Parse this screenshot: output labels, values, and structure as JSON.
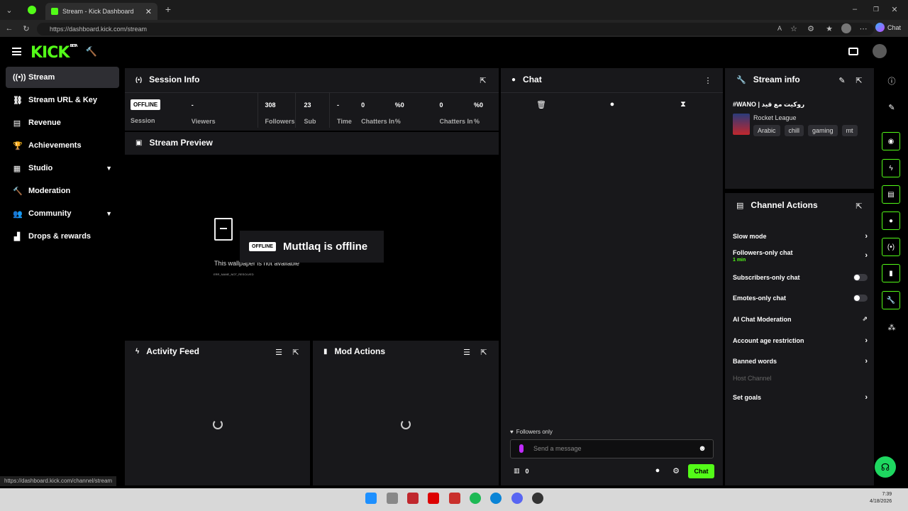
{
  "browser": {
    "tab_title": "Stream - Kick Dashboard",
    "url": "https://dashboard.kick.com/stream",
    "copilot_label": "Chat",
    "status_url": "https://dashboard.kick.com/channel/stream",
    "clock_time": "7:39",
    "clock_date": "4/18/2026"
  },
  "brand": {
    "logo": "KICK",
    "logo_sup": "BETA",
    "accent": "#53fc18"
  },
  "sidebar": {
    "items": [
      {
        "label": "Stream",
        "icon": "broadcast-icon"
      },
      {
        "label": "Stream URL & Key",
        "icon": "link-icon"
      },
      {
        "label": "Revenue",
        "icon": "revenue-icon"
      },
      {
        "label": "Achievements",
        "icon": "trophy-icon"
      },
      {
        "label": "Studio",
        "icon": "studio-icon"
      },
      {
        "label": "Moderation",
        "icon": "hammer-icon"
      },
      {
        "label": "Community",
        "icon": "community-icon"
      },
      {
        "label": "Drops & rewards",
        "icon": "gift-icon"
      }
    ]
  },
  "session": {
    "title": "Session Info",
    "status_badge": "OFFLINE",
    "status_label": "Session",
    "stats": [
      {
        "value": "-",
        "label": "Viewers"
      },
      {
        "value": "308",
        "label": "Followers"
      },
      {
        "value": "23",
        "label": "Sub Counts"
      },
      {
        "value": "-",
        "label": "Time Live"
      },
      {
        "value": "0",
        "label": "Chatters In Avg"
      },
      {
        "value": "%0",
        "label": "% Participation"
      },
      {
        "value": "0",
        "label": "Chatters In Avg"
      },
      {
        "value": "%0",
        "label": "% Participation"
      }
    ]
  },
  "preview": {
    "title": "Stream Preview",
    "error_text": "This wallpaper is not available",
    "error_code": "ERR_NAME_NOT_RESOLVED",
    "badge": "OFFLINE",
    "offline_text": "Muttlaq is offline"
  },
  "activity": {
    "title": "Activity Feed"
  },
  "mod": {
    "title": "Mod Actions"
  },
  "chat": {
    "title": "Chat",
    "mode": "Followers only",
    "placeholder": "Send a message",
    "count": "0",
    "send_label": "Chat"
  },
  "stream_info": {
    "title": "Stream info",
    "stream_title": "#WANO | روكيت مع قيد",
    "category": "Rocket League",
    "tags": [
      "Arabic",
      "chill",
      "gaming",
      "mt"
    ]
  },
  "channel_actions": {
    "title": "Channel Actions",
    "items": [
      {
        "label": "Slow mode",
        "control": "chevron"
      },
      {
        "label": "Followers-only chat",
        "sub": "1 min",
        "control": "chevron"
      },
      {
        "label": "Subscribers-only chat",
        "control": "toggle"
      },
      {
        "label": "Emotes-only chat",
        "control": "toggle"
      },
      {
        "label": "AI Chat Moderation",
        "control": "external"
      },
      {
        "label": "Account age restriction",
        "control": "chevron"
      },
      {
        "label": "Banned words",
        "control": "chevron"
      },
      {
        "label": "Host Channel",
        "control": "disabled"
      },
      {
        "label": "Set goals",
        "control": "chevron"
      }
    ]
  }
}
